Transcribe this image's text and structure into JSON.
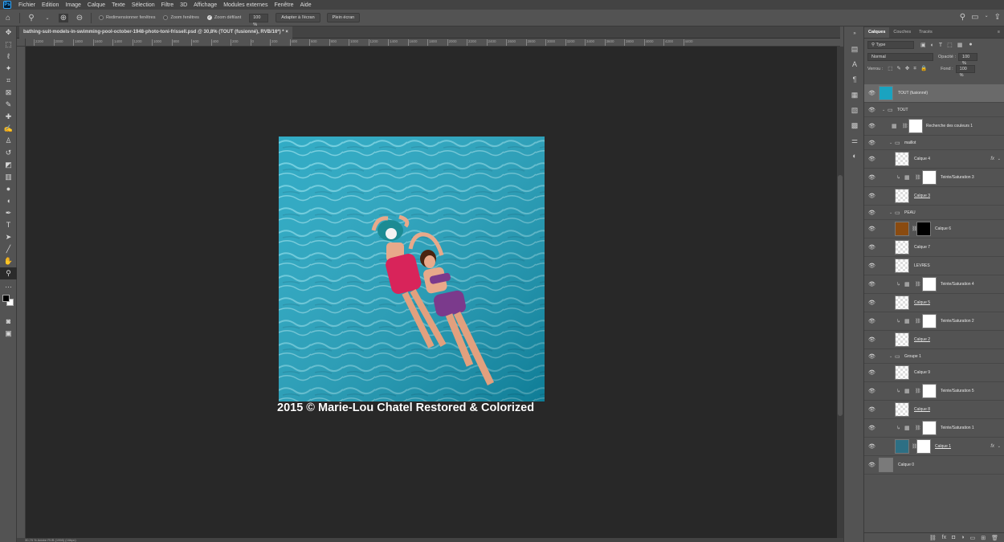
{
  "menubar": {
    "items": [
      "Fichier",
      "Edition",
      "Image",
      "Calque",
      "Texte",
      "Sélection",
      "Filtre",
      "3D",
      "Affichage",
      "Modules externes",
      "Fenêtre",
      "Aide"
    ]
  },
  "options": {
    "resize_windows": "Redimensionner fenêtres",
    "zoom_windows": "Zoom fenêtres",
    "scrubby_zoom": "Zoom défilant",
    "zoom_value": "100 %",
    "fit_screen": "Adapter à l'écran",
    "full_screen": "Plein écran"
  },
  "document": {
    "tab_title": "bathing-suit-models-in-swimming-pool-october-1948-photo-toni-frissell.psd @ 30,8% (TOUT (fusionné), RVB/16*) *",
    "watermark": "2015 © Marie-Lou Chatel Restored & Colorized",
    "status": "30,79 %   Adobe RVB (1998) (16bpc)"
  },
  "rulers": {
    "h": [
      "2200",
      "2000",
      "1800",
      "1600",
      "1400",
      "1200",
      "1000",
      "800",
      "600",
      "400",
      "200",
      "0",
      "200",
      "400",
      "600",
      "800",
      "1000",
      "1200",
      "1400",
      "1600",
      "1800",
      "2000",
      "2200",
      "2400",
      "2600",
      "2800",
      "3000",
      "3200",
      "3400",
      "3600",
      "3800",
      "4000",
      "4200",
      "4400"
    ]
  },
  "panel": {
    "tabs": [
      "Calques",
      "Couches",
      "Tracés"
    ],
    "filter_label": "Type",
    "blend_mode": "Normal",
    "opacity_label": "Opacité :",
    "opacity_value": "100 %",
    "lock_label": "Verrou :",
    "fill_label": "Fond :",
    "fill_value": "100 %"
  },
  "layers": [
    {
      "name": "TOUT (fusionné)",
      "kind": "merged",
      "indent": 0
    },
    {
      "name": "TOUT",
      "kind": "group",
      "indent": 0
    },
    {
      "name": "Recherche des couleurs 1",
      "kind": "adjust",
      "indent": 1
    },
    {
      "name": "maillot",
      "kind": "group",
      "indent": 1
    },
    {
      "name": "Calque 4",
      "kind": "pixel",
      "indent": 2,
      "fx": true
    },
    {
      "name": "Teinte/Saturation 3",
      "kind": "clip-adjust",
      "indent": 2
    },
    {
      "name": "Calque 3",
      "kind": "pixel",
      "indent": 2,
      "underline": true
    },
    {
      "name": "PEAU",
      "kind": "group",
      "indent": 1
    },
    {
      "name": "Calque 6",
      "kind": "masked-brown",
      "indent": 2
    },
    {
      "name": "Calque 7",
      "kind": "pixel",
      "indent": 2
    },
    {
      "name": "LEVRES",
      "kind": "pixel",
      "indent": 2
    },
    {
      "name": "Teinte/Saturation 4",
      "kind": "clip-adjust",
      "indent": 2
    },
    {
      "name": "Calque 5",
      "kind": "pixel",
      "indent": 2,
      "underline": true
    },
    {
      "name": "Teinte/Saturation 2",
      "kind": "clip-adjust",
      "indent": 2
    },
    {
      "name": "Calque 2",
      "kind": "pixel",
      "indent": 2,
      "underline": true
    },
    {
      "name": "Groupe 1",
      "kind": "group",
      "indent": 1
    },
    {
      "name": "Calque 9",
      "kind": "pixel",
      "indent": 2
    },
    {
      "name": "Teinte/Saturation 5",
      "kind": "clip-adjust",
      "indent": 2
    },
    {
      "name": "Calque 8",
      "kind": "pixel",
      "indent": 2,
      "underline": true
    },
    {
      "name": "Teinte/Saturation 1",
      "kind": "clip-adjust",
      "indent": 2
    },
    {
      "name": "Calque 1",
      "kind": "masked-teal",
      "indent": 2,
      "fx": true,
      "underline": true
    },
    {
      "name": "Calque 0",
      "kind": "photo",
      "indent": 0
    }
  ],
  "colors": {
    "pool": "#1aa3c0",
    "canvas": "#282828",
    "ui": "#535353"
  }
}
